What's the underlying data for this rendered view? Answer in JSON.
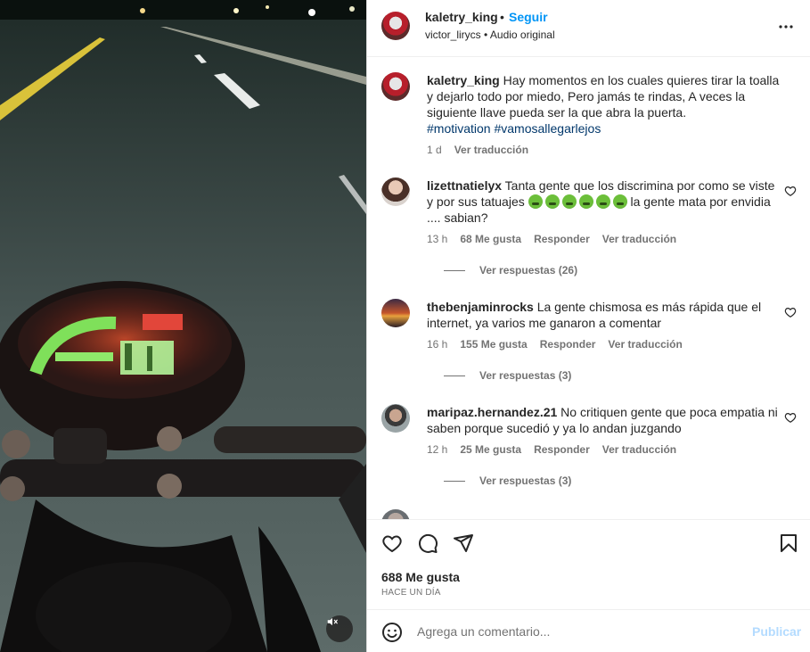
{
  "post": {
    "username": "kaletry_king",
    "dot": "•",
    "follow_label": "Seguir",
    "audio_user": "victor_lirycs",
    "audio_sep": " • ",
    "audio_label": "Audio original",
    "more_icon": "more-horizontal-icon"
  },
  "caption": {
    "username": "kaletry_king",
    "text": "Hay momentos en los cuales quieres tirar la toalla y dejarlo todo por miedo, Pero jamás te rindas, A veces la siguiente llave pueda ser la que abra la puerta.",
    "hashtag1": "#motivation",
    "hashtag2": "#vamosallegarlejos",
    "time": "1 d",
    "translate": "Ver traducción"
  },
  "comments": [
    {
      "username": "lizettnatielyx",
      "text_before": "Tanta gente que los discrimina por como se viste y por sus tatuajes",
      "emojis": [
        "nauseated-face",
        "nauseated-face",
        "nauseated-face",
        "nauseated-face",
        "nauseated-face",
        "nauseated-face"
      ],
      "text_after": "la gente mata por envidia .... sabian?",
      "time": "13 h",
      "likes": "68 Me gusta",
      "reply": "Responder",
      "translate": "Ver traducción",
      "replies": "Ver respuestas (26)"
    },
    {
      "username": "thebenjaminrocks",
      "text": "La gente chismosa es más rápida que el internet, ya varios me ganaron a comentar",
      "time": "16 h",
      "likes": "155 Me gusta",
      "reply": "Responder",
      "translate": "Ver traducción",
      "replies": "Ver respuestas (3)"
    },
    {
      "username": "maripaz.hernandez.21",
      "text": "No critiquen gente que poca empatia ni saben porque sucedió y ya lo andan juzgando",
      "time": "12 h",
      "likes": "25 Me gusta",
      "reply": "Responder",
      "translate": "Ver traducción",
      "replies": "Ver respuestas (3)"
    }
  ],
  "actions": {
    "like_icon": "heart-icon",
    "comment_icon": "comment-icon",
    "share_icon": "paper-plane-icon",
    "save_icon": "bookmark-icon",
    "likes_count": "688 Me gusta",
    "posted": "HACE UN DÍA"
  },
  "composer": {
    "placeholder": "Agrega un comentario...",
    "publish_label": "Publicar",
    "emoji_icon": "smiley-icon"
  },
  "media": {
    "mute_icon": "speaker-muted-icon"
  },
  "colors": {
    "link_blue": "#0095f6",
    "hashtag": "#00376b",
    "muted_text": "#737373",
    "publish_disabled": "#b3dbff"
  }
}
